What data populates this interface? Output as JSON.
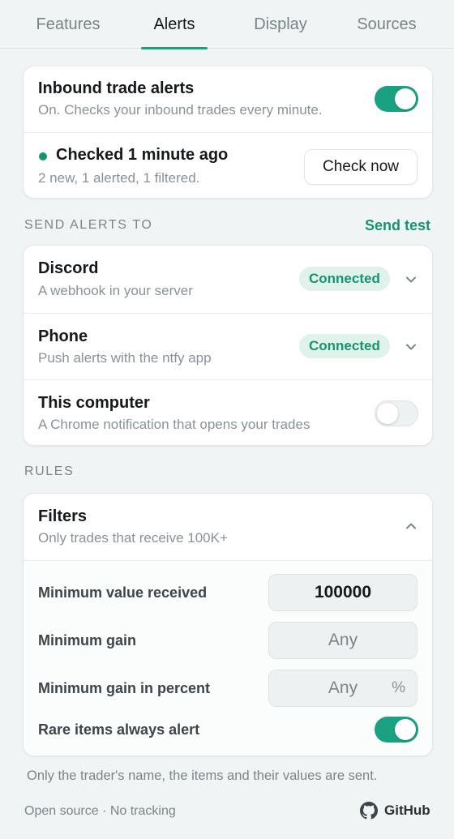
{
  "tabs": [
    {
      "label": "Features"
    },
    {
      "label": "Alerts"
    },
    {
      "label": "Display"
    },
    {
      "label": "Sources"
    }
  ],
  "active_tab": "Alerts",
  "inbound": {
    "title": "Inbound trade alerts",
    "subtitle": "On. Checks your inbound trades every minute.",
    "toggle_on": true,
    "status_title": "Checked 1 minute ago",
    "status_sub": "2 new, 1 alerted, 1 filtered.",
    "check_now_label": "Check now",
    "status_color": "#16946f"
  },
  "send_alerts": {
    "heading": "SEND ALERTS TO",
    "send_test_label": "Send test",
    "items": [
      {
        "title": "Discord",
        "subtitle": "A webhook in your server",
        "badge": "Connected"
      },
      {
        "title": "Phone",
        "subtitle": "Push alerts with the ntfy app",
        "badge": "Connected"
      },
      {
        "title": "This computer",
        "subtitle": "A Chrome notification that opens your trades",
        "toggle_on": false
      }
    ]
  },
  "rules": {
    "heading": "RULES",
    "filters_title": "Filters",
    "filters_sub": "Only trades that receive 100K+",
    "fields": [
      {
        "label": "Minimum value received",
        "value": "100000"
      },
      {
        "label": "Minimum gain",
        "value": "Any"
      },
      {
        "label": "Minimum gain in percent",
        "value": "Any",
        "suffix": "%"
      }
    ],
    "rare_label": "Rare items always alert",
    "rare_toggle_on": true
  },
  "privacy_note": "Only the trader's name, the items and their values are sent.",
  "footer": {
    "left": "Open source · No tracking",
    "github_label": "GitHub",
    "github_icon": "github-icon"
  },
  "colors": {
    "accent": "#1aa181",
    "badge_bg": "#dff3ea",
    "badge_text": "#16946f"
  }
}
